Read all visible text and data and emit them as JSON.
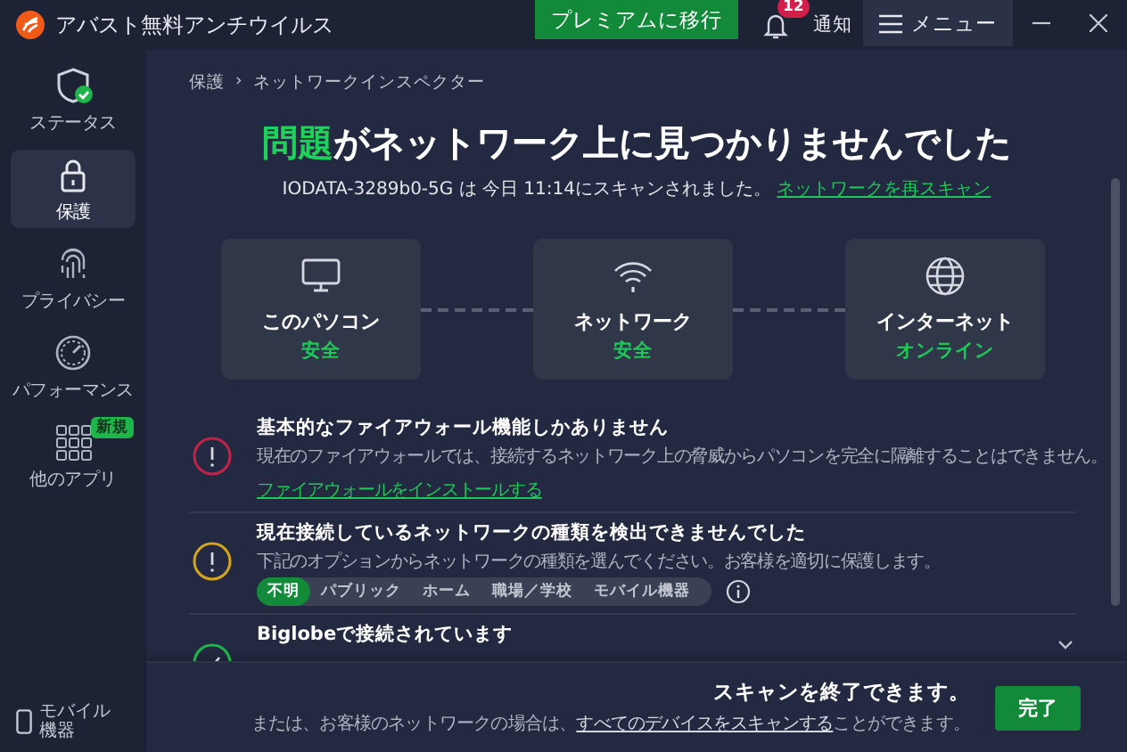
{
  "window": {
    "title": "アバスト無料アンチウイルス",
    "premium_button": "プレミアムに移行",
    "notifications": {
      "count": "12",
      "label": "通知"
    },
    "menu_button": "メニュー"
  },
  "sidebar": {
    "items": [
      {
        "label": "ステータス",
        "selected": false
      },
      {
        "label": "保護",
        "selected": true
      },
      {
        "label": "プライバシー",
        "selected": false
      },
      {
        "label": "パフォーマンス",
        "selected": false
      },
      {
        "label": "他のアプリ",
        "selected": false,
        "badge": "新規"
      }
    ],
    "bottom_item": "モバイル機器"
  },
  "breadcrumb": {
    "items": [
      "保護",
      "ネットワークインスペクター"
    ],
    "separator": "›"
  },
  "heading": {
    "highlight": "問題",
    "text": "がネットワーク上に見つかりませんでした"
  },
  "scan_info": {
    "text": "IODATA-3289b0-5G は 今日 11:14にスキャンされました。",
    "link": "ネットワークを再スキャン"
  },
  "nodes": [
    {
      "label": "このパソコン",
      "status": "安全"
    },
    {
      "label": "ネットワーク",
      "status": "安全"
    },
    {
      "label": "インターネット",
      "status": "オンライン"
    }
  ],
  "issues": [
    {
      "kind": "error",
      "title": "基本的なファイアウォール機能しかありません",
      "text": "現在のファイアウォールでは、接続するネットワーク上の脅威からパソコンを完全に隔離することはできません。",
      "link": "ファイアウォールをインストールする"
    },
    {
      "kind": "warning",
      "title": "現在接続しているネットワークの種類を検出できませんでした",
      "text": "下記のオプションからネットワークの種類を選んでください。お客様を適切に保護します。",
      "options": [
        {
          "label": "不明",
          "selected": true
        },
        {
          "label": "パブリック",
          "selected": false
        },
        {
          "label": "ホーム",
          "selected": false
        },
        {
          "label": "職場／学校",
          "selected": false
        },
        {
          "label": "モバイル機器",
          "selected": false
        }
      ]
    },
    {
      "kind": "ok",
      "title": "Biglobeで接続されています",
      "expandable": true
    }
  ],
  "footer": {
    "title": "スキャンを終了できます。",
    "prefix": "または、お客様のネットワークの場合は、",
    "link": "すべてのデバイスをスキャンする",
    "suffix": "ことができます。",
    "button": "完了"
  }
}
